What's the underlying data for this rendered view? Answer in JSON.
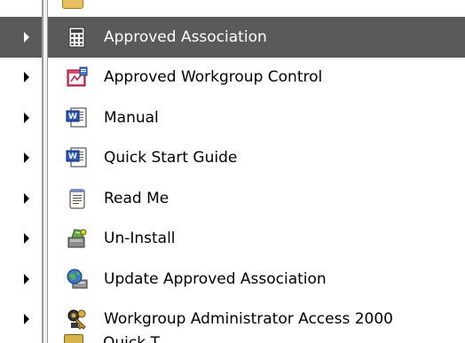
{
  "menu": {
    "items": [
      {
        "label": "Approved Association",
        "icon": "calculator-doc-icon",
        "selected": true
      },
      {
        "label": "Approved Workgroup Control",
        "icon": "form-window-icon",
        "selected": false
      },
      {
        "label": "Manual",
        "icon": "word-document-icon",
        "selected": false
      },
      {
        "label": "Quick Start Guide",
        "icon": "word-document-icon",
        "selected": false
      },
      {
        "label": "Read Me",
        "icon": "notepad-icon",
        "selected": false
      },
      {
        "label": "Un-Install",
        "icon": "uninstall-icon",
        "selected": false
      },
      {
        "label": "Update Approved Association",
        "icon": "update-globe-icon",
        "selected": false
      },
      {
        "label": "Workgroup Administrator Access 2000",
        "icon": "access-keys-icon",
        "selected": false
      }
    ]
  },
  "peek": {
    "bottom_label": "Quick T..."
  },
  "colors": {
    "selection": "#5a5a5a",
    "selected_text": "#ffffff",
    "text": "#000000"
  }
}
